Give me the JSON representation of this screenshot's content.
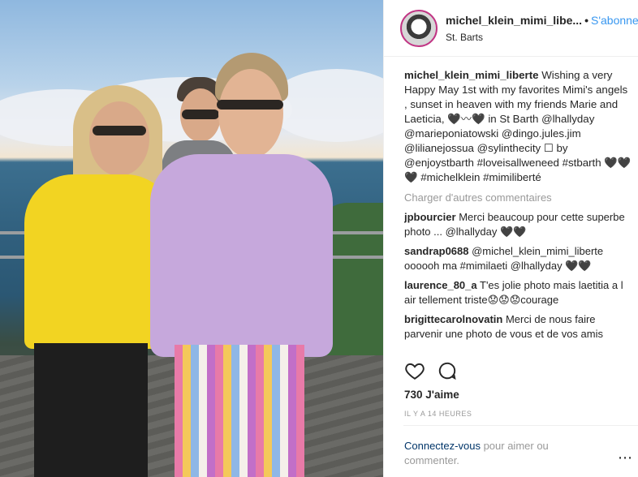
{
  "post": {
    "username": "michel_klein_mimi_libe...",
    "separator": "•",
    "follow_label": "S'abonner",
    "location": "St. Barts"
  },
  "caption": {
    "username": "michel_klein_mimi_liberte",
    "text": " Wishing a very Happy May 1st with my favorites Mimi's angels , sunset in heaven with my friends Marie and Laeticia, 🖤〰🖤 in St Barth @lhallyday @marieponiatowski @dingo.jules.jim @lilianejossua @sylinthecity ☐ by @enjoystbarth #loveisallweneed #stbarth 🖤🖤🖤 #michelklein #mimiliberté"
  },
  "load_more": "Charger d'autres commentaires",
  "comments": [
    {
      "user": "jpbourcier",
      "text": " Merci beaucoup pour cette superbe photo ... @lhallyday 🖤🖤"
    },
    {
      "user": "sandrap0688",
      "text": " @michel_klein_mimi_liberte oooooh ma #mimilaeti @lhallyday 🖤🖤"
    },
    {
      "user": "laurence_80_a",
      "text": " T'es jolie photo mais laetitia a l air tellement triste😟😟😟courage"
    },
    {
      "user": "brigittecarolnovatin",
      "text": " Merci de nous faire parvenir une photo de vous et de vos amis"
    }
  ],
  "likes": "730 J'aime",
  "time": "IL Y A 14 HEURES",
  "login": {
    "link": "Connectez-vous",
    "text": " pour aimer ou commenter."
  },
  "menu_icon": "⋯",
  "icons": [
    "heart-icon",
    "comment-icon",
    "more-options-icon"
  ],
  "colors": {
    "link": "#3897f0",
    "muted": "#999999",
    "text": "#262626",
    "ring": "#c13584"
  }
}
